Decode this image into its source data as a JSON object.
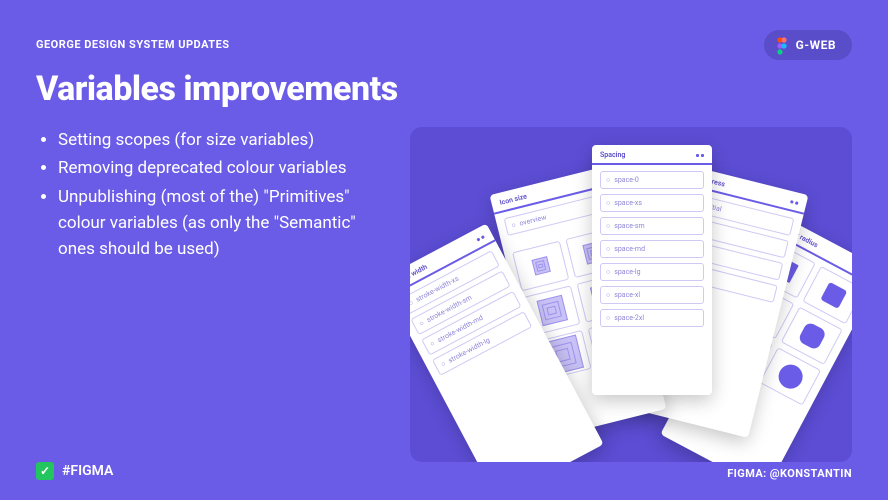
{
  "kicker": "GEORGE DESIGN SYSTEM UPDATES",
  "title": "Variables improvements",
  "badge": {
    "label": "G-WEB"
  },
  "bullets": [
    "Setting scopes (for size variables)",
    "Removing deprecated colour variables",
    "Unpublishing (most of the) \"Primitives\" colour variables (as only the \"Semantic\" ones should be used)"
  ],
  "illustration": {
    "panels": [
      {
        "title": "Stroke width"
      },
      {
        "title": "Icon size"
      },
      {
        "title": "Spacing"
      },
      {
        "title": "Progress"
      },
      {
        "title": "Border radius"
      }
    ]
  },
  "footer": {
    "left_hashtag": "#FIGMA",
    "right": "FIGMA: @KONSTANTIN"
  }
}
